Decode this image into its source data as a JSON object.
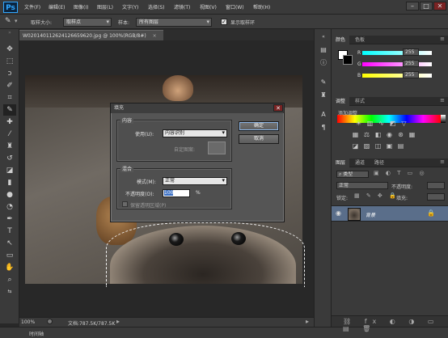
{
  "app": {
    "logo": "Ps"
  },
  "menu": [
    "文件(F)",
    "编辑(E)",
    "图像(I)",
    "图层(L)",
    "文字(Y)",
    "选择(S)",
    "滤镜(T)",
    "视图(V)",
    "窗口(W)",
    "帮助(H)"
  ],
  "window_controls": {
    "minimize": "–",
    "maximize": "□",
    "close": "✕"
  },
  "options": {
    "sample_size_label": "取样大小:",
    "sample_size_value": "取样点",
    "sample_label": "样本:",
    "sample_value": "所有图层",
    "show_ring_label": "显示取样环",
    "show_ring_checked": true
  },
  "document_tab": {
    "title": "W020140112624126659620.jpg @ 100%(RGB/8#)",
    "close": "×"
  },
  "status": {
    "zoom": "100%",
    "doc_size": "文档:787.5K/787.5K"
  },
  "timeline": {
    "label": "时间轴"
  },
  "dialog": {
    "title": "填充",
    "close": "✕",
    "content_legend": "内容",
    "use_label": "使用(U):",
    "use_value": "内容识别",
    "custom_pattern_label": "自定图案:",
    "blend_legend": "混合",
    "mode_label": "模式(M):",
    "mode_value": "正常",
    "opacity_label": "不透明度(O):",
    "opacity_value": "100",
    "opacity_unit": "%",
    "preserve_label": "保留透明区域(P)",
    "preserve_checked": false,
    "ok": "确定",
    "cancel": "取消"
  },
  "color_panel": {
    "tabs": [
      "颜色",
      "色板"
    ],
    "channels": [
      {
        "name": "R",
        "value": "255",
        "gradient": "#ff4fff"
      },
      {
        "name": "G",
        "value": "255",
        "gradient": "#4fff4f"
      },
      {
        "name": "B",
        "value": "255",
        "gradient": "#4f4fff"
      }
    ]
  },
  "adjust_panel": {
    "tabs": [
      "调整",
      "样式"
    ],
    "heading": "添加调整"
  },
  "layers_panel": {
    "tabs": [
      "图层",
      "通道",
      "路径"
    ],
    "filter_kind": "类型",
    "blend_mode": "正常",
    "opacity_label": "不透明度:",
    "lock_label": "锁定:",
    "fill_label": "填充:",
    "layer_name": "背景"
  }
}
